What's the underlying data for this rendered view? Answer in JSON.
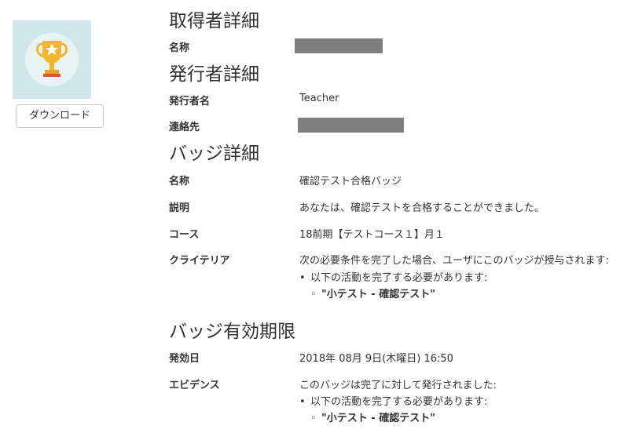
{
  "download_label": "ダウンロード",
  "recipient": {
    "heading": "取得者詳細",
    "name_label": "名称"
  },
  "issuer": {
    "heading": "発行者詳細",
    "name_label": "発行者名",
    "name_value": "Teacher",
    "contact_label": "連絡先"
  },
  "badge": {
    "heading": "バッジ詳細",
    "name_label": "名称",
    "name_value": "確認テスト合格バッジ",
    "desc_label": "説明",
    "desc_value": "あなたは、確認テストを合格することができました。",
    "course_label": "コース",
    "course_value": "18前期【テストコース１】月１",
    "criteria_label": "クライテリア",
    "criteria_intro": "次の必要条件を完了した場合、ユーザにこのバッジが授与されます:",
    "criteria_item": "以下の活動を完了する必要があります:",
    "criteria_subitem": "\"小テスト - 確認テスト\""
  },
  "expiry": {
    "heading": "バッジ有効期限",
    "issued_label": "発効日",
    "issued_value": "2018年 08月 9日(木曜日) 16:50",
    "evidence_label": "エビデンス",
    "evidence_intro": "このバッジは完了に対して発行されました:",
    "evidence_item": "以下の活動を完了する必要があります:",
    "evidence_subitem": "\"小テスト - 確認テスト\""
  },
  "bullets": {
    "level1": "•",
    "level2": "◦"
  }
}
